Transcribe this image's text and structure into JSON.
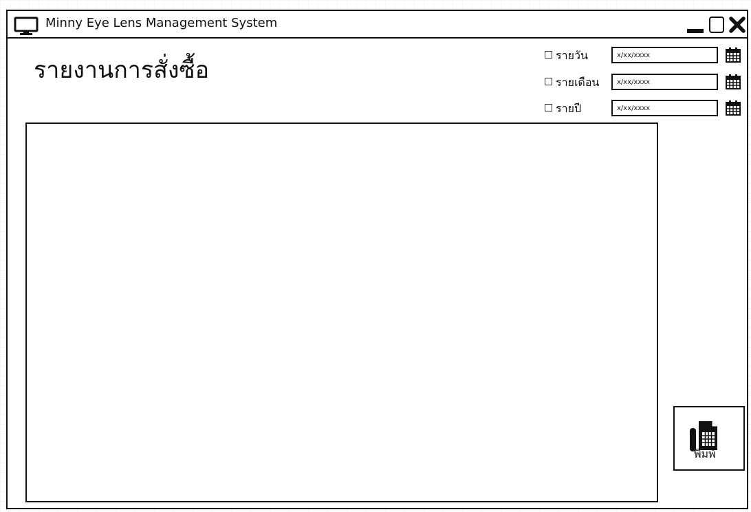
{
  "window": {
    "title": "Minny Eye Lens Management System"
  },
  "page": {
    "heading": "รายงานการสั่งซื้อ"
  },
  "filters": [
    {
      "label": "รายวัน",
      "placeholder": "x/xx/xxxx",
      "checked": false
    },
    {
      "label": "รายเดือน",
      "placeholder": "x/xx/xxxx",
      "checked": false
    },
    {
      "label": "รายปี",
      "placeholder": "x/xx/xxxx",
      "checked": false
    }
  ],
  "actions": {
    "print_label": "พิมพ์"
  },
  "icons": {
    "app": "monitor-icon",
    "calendar": "calendar-icon",
    "print": "printer-icon",
    "minimize": "minimize-icon",
    "maximize": "maximize-icon",
    "close": "close-icon"
  }
}
